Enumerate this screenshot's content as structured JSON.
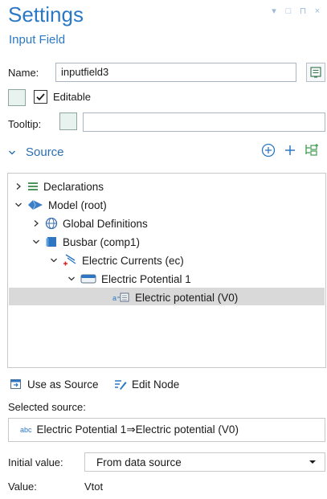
{
  "panel": {
    "title": "Settings",
    "subtitle": "Input Field"
  },
  "window_controls": [
    "▾",
    "□",
    "⊓",
    "×"
  ],
  "name_field": {
    "label": "Name:",
    "value": "inputfield3"
  },
  "editable": {
    "label": "Editable",
    "checked": true
  },
  "tooltip_field": {
    "label": "Tooltip:",
    "value": ""
  },
  "source_section": {
    "label": "Source"
  },
  "tree": {
    "nodes": [
      {
        "label": "Declarations",
        "chevron": "›",
        "icon": "declarations-icon"
      },
      {
        "label": "Model (root)",
        "chevron": "⌄",
        "icon": "model-icon"
      },
      {
        "label": "Global Definitions",
        "chevron": "›",
        "icon": "globe-icon"
      },
      {
        "label": "Busbar (comp1)",
        "chevron": "⌄",
        "icon": "component-icon"
      },
      {
        "label": "Electric Currents (ec)",
        "chevron": "⌄",
        "icon": "electric-currents-icon"
      },
      {
        "label": "Electric Potential 1",
        "chevron": "⌄",
        "icon": "boundary-condition-icon"
      },
      {
        "label": "Electric potential (V0)",
        "chevron": "",
        "icon": "variable-icon"
      }
    ]
  },
  "toolbar": {
    "use_as_source": "Use as Source",
    "edit_node": "Edit Node"
  },
  "selected_source": {
    "label": "Selected source:",
    "prefix": "abc",
    "value": "Electric Potential 1⇒Electric potential (V0)"
  },
  "initial_value": {
    "label": "Initial value:",
    "selected": "From data source"
  },
  "value_row": {
    "label": "Value:",
    "value": "Vtot"
  }
}
